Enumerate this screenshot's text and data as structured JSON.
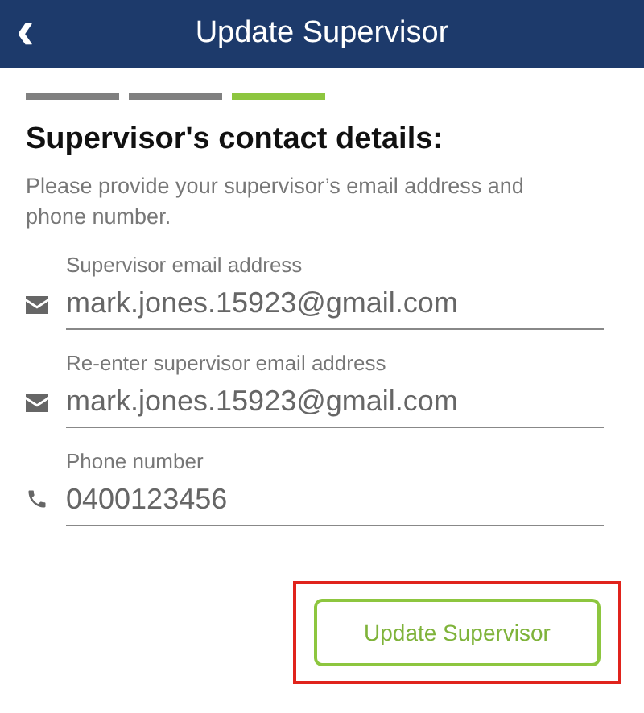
{
  "header": {
    "back_icon": "‹",
    "title": "Update Supervisor"
  },
  "steps": [
    {
      "selected": false
    },
    {
      "selected": false
    },
    {
      "selected": true
    }
  ],
  "heading": "Supervisor's contact details:",
  "description": "Please provide your supervisor’s email address and phone number.",
  "fields": [
    {
      "kind": "email",
      "label": "Supervisor email address",
      "value": "mark.jones.15923@gmail.com"
    },
    {
      "kind": "email",
      "label": "Re-enter supervisor email address",
      "value": "mark.jones.15923@gmail.com"
    },
    {
      "kind": "phone",
      "label": "Phone number",
      "value": "0400123456"
    }
  ],
  "button": {
    "label": "Update Supervisor",
    "highlighted": true
  }
}
